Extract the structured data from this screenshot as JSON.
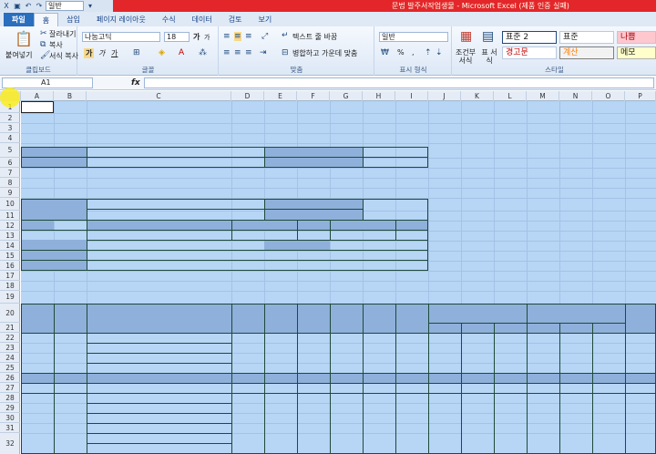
{
  "titlebar": {
    "title": "문법 발주서작업생물 - Microsoft Excel (제품 인증 실패)",
    "qat_font": "일반"
  },
  "tabs": [
    "파일",
    "홈",
    "삽입",
    "페이지 레이아웃",
    "수식",
    "데이터",
    "검토",
    "보기"
  ],
  "ribbon": {
    "clipboard": {
      "paste": "붙여넣기",
      "cut": "잘라내기",
      "copy": "복사",
      "format_painter": "서식 복사",
      "label": "클립보드"
    },
    "font": {
      "name": "나눔고딕",
      "size": "18",
      "label": "글꼴",
      "grow": "가",
      "shrink": "가",
      "bold": "가",
      "italic": "가",
      "underline": "가"
    },
    "alignment": {
      "wrap": "텍스트 줄 바꿈",
      "merge": "병합하고 가운데 맞춤",
      "label": "맞춤"
    },
    "number": {
      "format": "일반",
      "percent": "%",
      "comma": ",",
      "label": "표시 형식"
    },
    "styles": {
      "conditional": "조건부 서식",
      "table": "표 서식",
      "cells": [
        "표준 2",
        "표준",
        "나쁨",
        "경고문",
        "계산",
        "메모"
      ],
      "label": "스타일"
    }
  },
  "formula_bar": {
    "cell_ref": "A1",
    "fx": "fx",
    "value": ""
  },
  "columns": [
    "A",
    "B",
    "C",
    "D",
    "E",
    "F",
    "G",
    "H",
    "I",
    "J",
    "K",
    "L",
    "M",
    "N",
    "O",
    "P"
  ],
  "rows": [
    "1",
    "2",
    "3",
    "4",
    "5",
    "6",
    "7",
    "8",
    "9",
    "10",
    "11",
    "12",
    "13",
    "14",
    "15",
    "16",
    "17",
    "18",
    "19",
    "20",
    "21",
    "22",
    "23",
    "24",
    "25",
    "26",
    "27",
    "28",
    "29",
    "30",
    "31",
    "32"
  ],
  "colors": {
    "sheet_fill": "#b7d5f5",
    "header_fill": "#8fb0da",
    "border": "#1e4a3a",
    "title_bar": "#e3262a"
  }
}
